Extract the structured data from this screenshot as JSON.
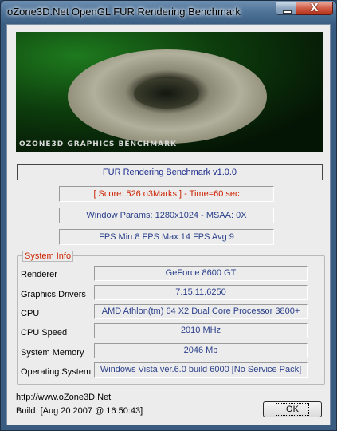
{
  "window": {
    "title": "oZone3D.Net OpenGL FUR Rendering Benchmark",
    "close_glyph": "X"
  },
  "banner": {
    "logo_text": "oZone3D Graphics Benchmark"
  },
  "header": {
    "version": "FUR Rendering Benchmark v1.0.0",
    "score": "[ Score: 526 o3Marks ] - Time=60 sec",
    "window_params": "Window Params: 1280x1024 - MSAA: 0X",
    "fps": "FPS Min:8  FPS Max:14  FPS Avg:9"
  },
  "system_info": {
    "title": "System Info",
    "rows": [
      {
        "label": "Renderer",
        "value": "GeForce 8600 GT"
      },
      {
        "label": "Graphics Drivers",
        "value": "7.15.11.6250"
      },
      {
        "label": "CPU",
        "value": "AMD Athlon(tm) 64 X2 Dual Core Processor 3800+"
      },
      {
        "label": "CPU Speed",
        "value": "2010 MHz"
      },
      {
        "label": "System Memory",
        "value": "2046 Mb"
      },
      {
        "label": "Operating System",
        "value": "Windows Vista ver.6.0 build 6000 [No Service Pack]"
      }
    ]
  },
  "footer": {
    "url": "http://www.oZone3D.Net",
    "build": "Build: [Aug 20 2007 @ 16:50:43]",
    "ok_label": "OK"
  }
}
